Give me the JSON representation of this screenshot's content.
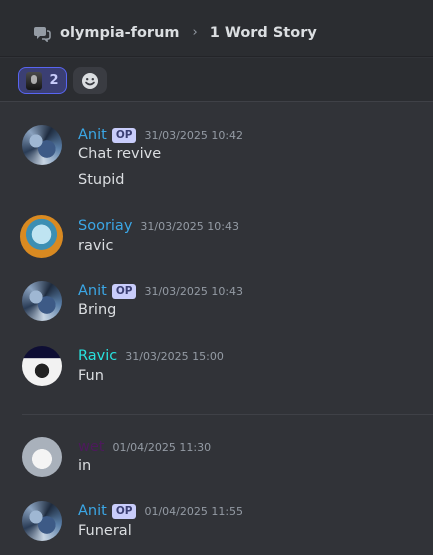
{
  "header": {
    "forum_name": "olympia-forum",
    "thread_title": "1 Word Story"
  },
  "reactions": [
    {
      "emoji": "custom-image-emoji",
      "count": "2",
      "active": true
    }
  ],
  "colors": {
    "background": "#313338",
    "op_name": "#3ba7e6",
    "sooriay_name": "#3ba7e6",
    "ravic_name": "#28e1de",
    "dark_user_name": "#4d1a5c",
    "op_badge_bg": "#c9cdfb"
  },
  "messages": [
    {
      "author": "Anit",
      "op_badge": "OP",
      "timestamp": "31/03/2025 10:42",
      "lines": [
        "Chat revive",
        "Stupid"
      ]
    },
    {
      "author": "Sooriay",
      "timestamp": "31/03/2025 10:43",
      "lines": [
        "ravic"
      ]
    },
    {
      "author": "Anit",
      "op_badge": "OP",
      "timestamp": "31/03/2025 10:43",
      "lines": [
        "Bring"
      ]
    },
    {
      "author": "Ravic",
      "timestamp": "31/03/2025 15:00",
      "lines": [
        "Fun"
      ]
    },
    {
      "author": "wet",
      "timestamp": "01/04/2025 11:30",
      "lines": [
        "in"
      ]
    },
    {
      "author": "Anit",
      "op_badge": "OP",
      "timestamp": "01/04/2025 11:55",
      "lines": [
        "Funeral"
      ]
    }
  ]
}
